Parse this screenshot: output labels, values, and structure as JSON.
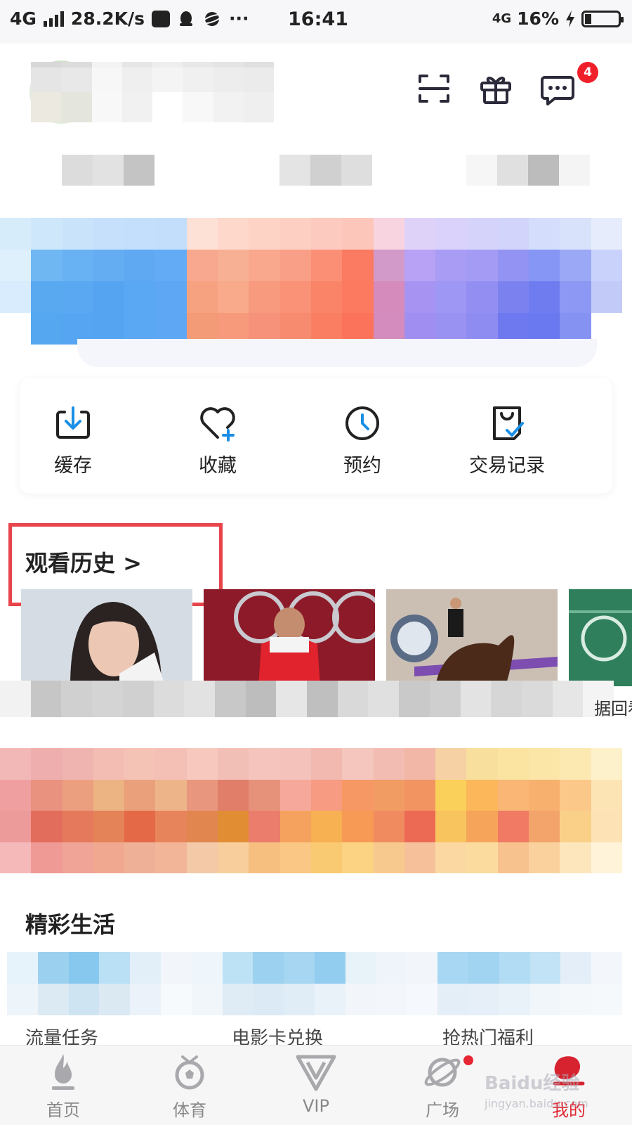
{
  "status_bar": {
    "network": "4G",
    "speed": "28.2K/s",
    "more": "···",
    "time": "16:41",
    "network_right": "4G",
    "battery": "16%"
  },
  "header": {
    "notification_count": "4",
    "icons": [
      "scan-icon",
      "gift-icon",
      "message-icon"
    ]
  },
  "quick_actions": [
    {
      "icon": "download-icon",
      "label": "缓存"
    },
    {
      "icon": "heart-plus-icon",
      "label": "收藏"
    },
    {
      "icon": "clock-icon",
      "label": "预约"
    },
    {
      "icon": "bag-check-icon",
      "label": "交易记录"
    }
  ],
  "history": {
    "title": "观看历史 >",
    "partial_text": "据回看"
  },
  "life_section": {
    "title": "精彩生活",
    "card_labels": [
      "流量任务",
      "电影卡兑换",
      "抢热门福利"
    ]
  },
  "tabbar": {
    "items": [
      {
        "label": "首页",
        "icon": "flame-icon"
      },
      {
        "label": "体育",
        "icon": "sport-icon"
      },
      {
        "label": "VIP",
        "icon": "vip-icon"
      },
      {
        "label": "广场",
        "icon": "planet-icon"
      },
      {
        "label": "我的",
        "icon": "profile-icon"
      }
    ],
    "active": "我的",
    "watermark": "Baidu经验",
    "watermark_sub": "jingyan.baidu.com"
  },
  "colors": {
    "accent_red": "#e02530",
    "icon_blue": "#1a8fe6",
    "highlight_box": "#e8444b"
  }
}
